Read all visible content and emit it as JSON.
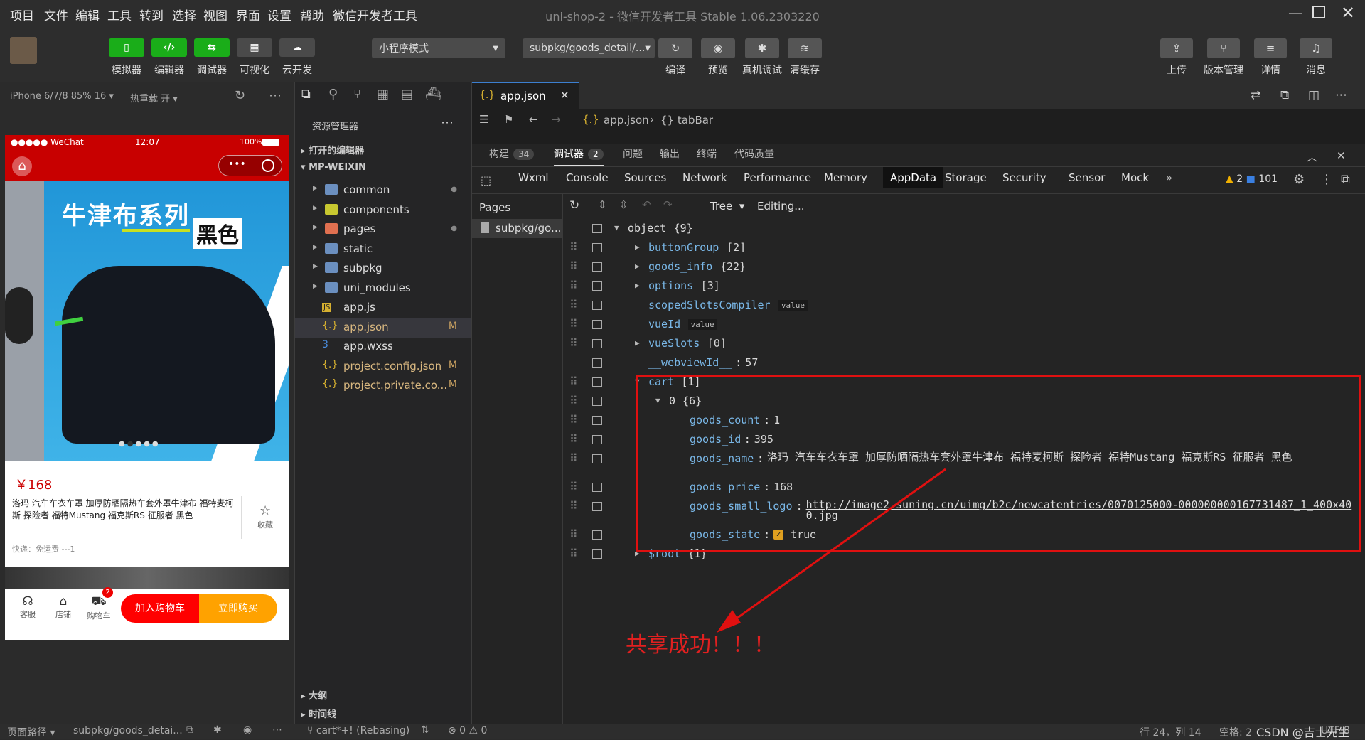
{
  "menu": [
    "项目",
    "文件",
    "编辑",
    "工具",
    "转到",
    "选择",
    "视图",
    "界面",
    "设置",
    "帮助",
    "微信开发者工具"
  ],
  "window_title": "uni-shop-2 - 微信开发者工具 Stable 1.06.2303220",
  "toolbar": {
    "buttons": [
      {
        "label": "模拟器",
        "icon": "▯"
      },
      {
        "label": "编辑器",
        "icon": "‹/›"
      },
      {
        "label": "调试器",
        "icon": "⇆"
      },
      {
        "label": "可视化",
        "icon": "▦"
      },
      {
        "label": "云开发",
        "icon": "☁"
      }
    ],
    "mode_select": "小程序模式",
    "page_select": "subpkg/goods_detail/...",
    "actions": [
      {
        "label": "编译",
        "icon": "↻"
      },
      {
        "label": "预览",
        "icon": "◉"
      },
      {
        "label": "真机调试",
        "icon": "✱"
      },
      {
        "label": "清缓存",
        "icon": "≋"
      }
    ],
    "right": [
      {
        "label": "上传",
        "icon": "⇪"
      },
      {
        "label": "版本管理",
        "icon": "⑂"
      },
      {
        "label": "详情",
        "icon": "≡"
      },
      {
        "label": "消息",
        "icon": "♫"
      }
    ]
  },
  "sim": {
    "device": "iPhone 6/7/8 85% 16",
    "hot_reload": "热重载 开"
  },
  "phone": {
    "status_left": "●●●●● WeChat",
    "time": "12:07",
    "battery": "100%",
    "banner_title": "牛津布系列",
    "banner_sub": "黑色",
    "price": "￥168",
    "goods_name": "洛玛 汽车车衣车罩 加厚防晒隔热车套外罩牛津布 福特麦柯斯 探险者 福特Mustang 福克斯RS 征服者 黑色",
    "fav_label": "收藏",
    "shipping": "快递：免运费 ---1",
    "nav": [
      {
        "label": "客服",
        "icon": "☊"
      },
      {
        "label": "店铺",
        "icon": "⌂"
      },
      {
        "label": "购物车",
        "icon": "⛟"
      }
    ],
    "cart_badge": "2",
    "btn_add": "加入购物车",
    "btn_buy": "立即购买"
  },
  "explorer": {
    "title": "资源管理器",
    "open_editors": "打开的编辑器",
    "project": "MP-WEIXIN",
    "items": [
      {
        "name": "common",
        "type": "folder",
        "color": "#6b8fbf",
        "badge": "●"
      },
      {
        "name": "components",
        "type": "folder",
        "color": "#c8c830",
        "badge": ""
      },
      {
        "name": "pages",
        "type": "folder",
        "color": "#e07050",
        "badge": "●"
      },
      {
        "name": "static",
        "type": "folder",
        "color": "#6b8fbf",
        "badge": ""
      },
      {
        "name": "subpkg",
        "type": "folder",
        "color": "#6b8fbf",
        "badge": ""
      },
      {
        "name": "uni_modules",
        "type": "folder",
        "color": "#6b8fbf",
        "badge": ""
      },
      {
        "name": "app.js",
        "type": "js",
        "color": "#d6b030",
        "badge": ""
      },
      {
        "name": "app.json",
        "type": "json",
        "color": "#d6b030",
        "badge": "M"
      },
      {
        "name": "app.wxss",
        "type": "css",
        "color": "#4b8fe0",
        "badge": ""
      },
      {
        "name": "project.config.json",
        "type": "json",
        "color": "#d6b030",
        "badge": "M"
      },
      {
        "name": "project.private.co...",
        "type": "json",
        "color": "#d6b030",
        "badge": "M"
      }
    ],
    "outline": "大纲",
    "timeline": "时间线"
  },
  "editor": {
    "tab": "app.json",
    "breadcrumb_file": "app.json",
    "breadcrumb_node": "tabBar"
  },
  "devtools": {
    "topbar": [
      {
        "label": "构建",
        "count": "34"
      },
      {
        "label": "调试器",
        "count": "2"
      },
      {
        "label": "问题",
        "count": ""
      },
      {
        "label": "输出",
        "count": ""
      },
      {
        "label": "终端",
        "count": ""
      },
      {
        "label": "代码质量",
        "count": ""
      }
    ],
    "tabs": [
      "Wxml",
      "Console",
      "Sources",
      "Network",
      "Performance",
      "Memory",
      "AppData",
      "Storage",
      "Security",
      "Sensor",
      "Mock"
    ],
    "warn_count": "2",
    "info_count": "101",
    "pages_label": "Pages",
    "page_item": "subpkg/go...",
    "view_mode": "Tree",
    "status": "Editing..."
  },
  "appdata": [
    {
      "indent": 0,
      "arrow": "▼",
      "key": "object",
      "val": "{9}",
      "plain": true,
      "handle": false
    },
    {
      "indent": 1,
      "arrow": "▶",
      "key": "buttonGroup",
      "val": "[2]",
      "handle": true
    },
    {
      "indent": 1,
      "arrow": "▶",
      "key": "goods_info",
      "val": "{22}",
      "handle": true
    },
    {
      "indent": 1,
      "arrow": "▶",
      "key": "options",
      "val": "[3]",
      "handle": true
    },
    {
      "indent": 1,
      "arrow": "",
      "key": "scopedSlotsCompiler",
      "val": "value",
      "boxed": true,
      "handle": true
    },
    {
      "indent": 1,
      "arrow": "",
      "key": "vueId",
      "val": "value",
      "boxed": true,
      "handle": true
    },
    {
      "indent": 1,
      "arrow": "▶",
      "key": "vueSlots",
      "val": "[0]",
      "handle": true
    },
    {
      "indent": 1,
      "arrow": "",
      "key": "__webviewId__",
      "val": "57",
      "colon": true,
      "handle": false
    },
    {
      "indent": 1,
      "arrow": "▼",
      "key": "cart",
      "val": "[1]",
      "handle": true
    },
    {
      "indent": 2,
      "arrow": "▼",
      "key": "0",
      "val": "{6}",
      "plain": true,
      "handle": true
    },
    {
      "indent": 3,
      "arrow": "",
      "key": "goods_count",
      "val": "1",
      "colon": true,
      "handle": true
    },
    {
      "indent": 3,
      "arrow": "",
      "key": "goods_id",
      "val": "395",
      "colon": true,
      "handle": true
    },
    {
      "indent": 3,
      "arrow": "",
      "key": "goods_name",
      "val": "洛玛 汽车车衣车罩 加厚防晒隔热车套外罩牛津布 福特麦柯斯 探险者 福特Mustang 福克斯RS 征服者 黑色",
      "colon": true,
      "handle": true,
      "tall": true
    },
    {
      "indent": 3,
      "arrow": "",
      "key": "goods_price",
      "val": "168",
      "colon": true,
      "handle": true
    },
    {
      "indent": 3,
      "arrow": "",
      "key": "goods_small_logo",
      "val": "http://image2.suning.cn/uimg/b2c/newcatentries/0070125000-000000000167731487_1_400x400.jpg",
      "colon": true,
      "handle": true,
      "link": true,
      "tall": true
    },
    {
      "indent": 3,
      "arrow": "",
      "key": "goods_state",
      "val": "true",
      "colon": true,
      "handle": true,
      "check": true
    },
    {
      "indent": 1,
      "arrow": "▶",
      "key": "$root",
      "val": "{1}",
      "handle": true
    }
  ],
  "annotation": "共享成功！！！",
  "statusbar": {
    "left_path": "页面路径",
    "page": "subpkg/goods_detai...",
    "git": "cart*+! (Rebasing)",
    "errors": "⊗ 0 ⚠ 0",
    "position": "行 24，列 14",
    "spaces": "空格: 2",
    "encoding": "UTF-8",
    "watermark": "CSDN @吉士先生"
  }
}
